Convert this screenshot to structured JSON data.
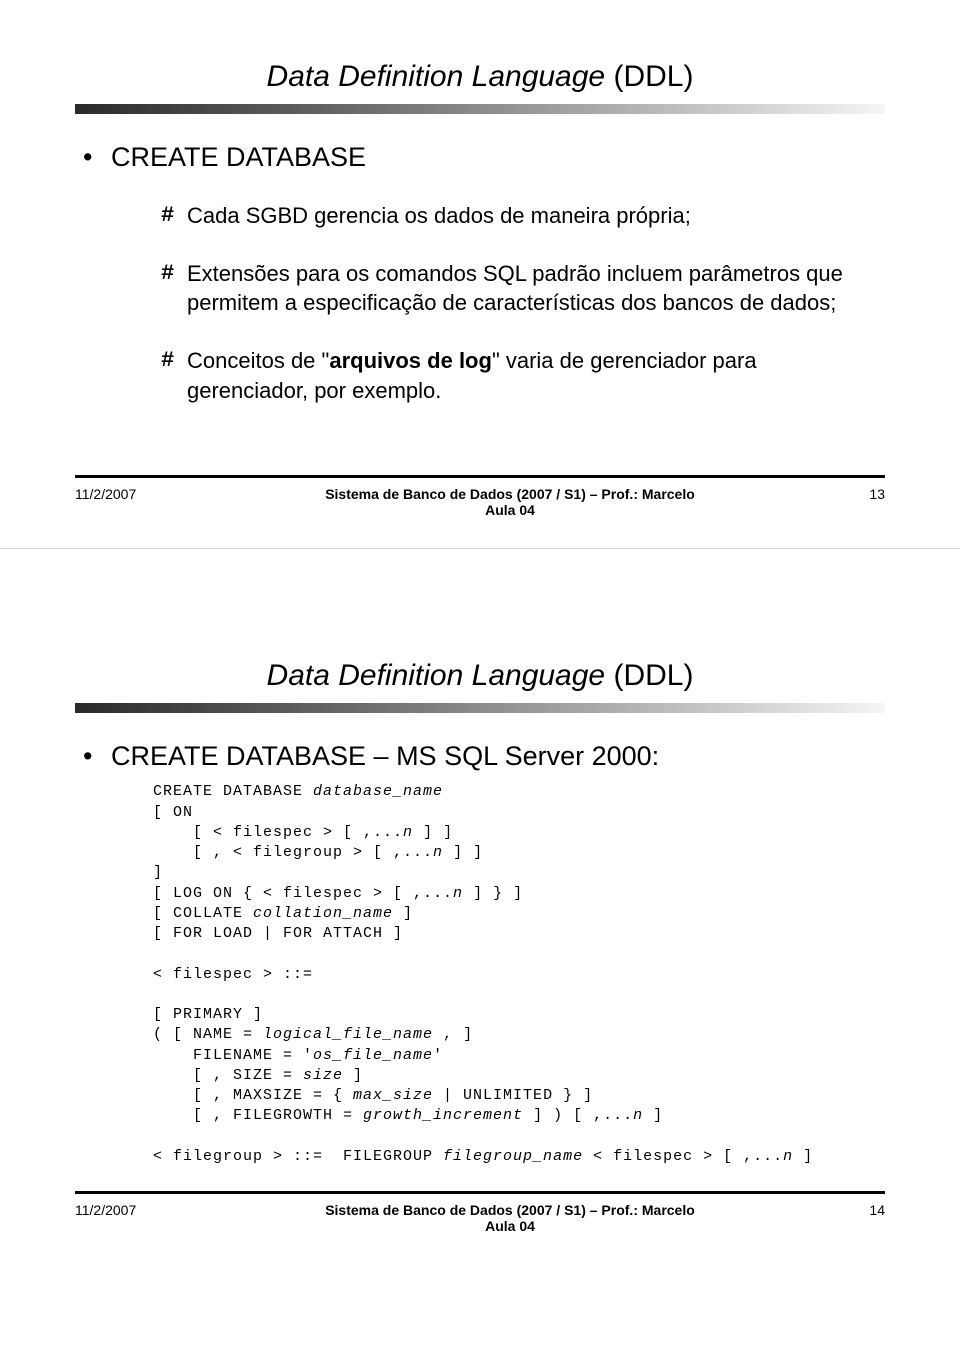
{
  "slide1": {
    "title_ital": "Data Definition Language",
    "title_rest": " (DDL)",
    "h1": "CREATE DATABASE",
    "p1": "Cada SGBD gerencia os dados de maneira própria;",
    "p2": "Extensões para os comandos SQL padrão incluem parâmetros que permitem a especificação de características dos bancos de dados;",
    "p3_pre": "Conceitos de \"",
    "p3_bold": "arquivos de log",
    "p3_post": "\" varia de gerenciador para gerenciador, por exemplo.",
    "footer": {
      "date": "11/2/2007",
      "center_l1": "Sistema de Banco de Dados (2007 / S1) – Prof.: Marcelo",
      "center_l2": "Aula 04",
      "num": "13"
    }
  },
  "slide2": {
    "title_ital": "Data Definition Language",
    "title_rest": " (DDL)",
    "h1": "CREATE DATABASE – MS SQL Server 2000:",
    "code": {
      "l01a": "CREATE DATABASE ",
      "l01b": "database_name",
      "l02": "[ ON",
      "l03a": "    [ < filespec > [ ,...",
      "l03b": "n",
      "l03c": " ] ]",
      "l04a": "    [ , < filegroup > [ ,...",
      "l04b": "n",
      "l04c": " ] ]",
      "l05": "]",
      "l06a": "[ LOG ON { < filespec > [ ,...",
      "l06b": "n",
      "l06c": " ] } ]",
      "l07a": "[ COLLATE ",
      "l07b": "collation_name",
      "l07c": " ]",
      "l08": "[ FOR LOAD | FOR ATTACH ]",
      "l09": "",
      "l10": "< filespec > ::=",
      "l11": "",
      "l12": "[ PRIMARY ]",
      "l13a": "( [ NAME = ",
      "l13b": "logical_file_name",
      "l13c": " , ]",
      "l14a": "    FILENAME = '",
      "l14b": "os_file_name",
      "l14c": "'",
      "l15a": "    [ , SIZE = ",
      "l15b": "size",
      "l15c": " ]",
      "l16a": "    [ , MAXSIZE = { ",
      "l16b": "max_size",
      "l16c": " | UNLIMITED } ]",
      "l17a": "    [ , FILEGROWTH = ",
      "l17b": "growth_increment",
      "l17c": " ] ) [ ,...",
      "l17d": "n",
      "l17e": " ]",
      "l18": "",
      "l19a": "< filegroup > ::=  FILEGROUP ",
      "l19b": "filegroup_name",
      "l19c": " < filespec > [ ,...",
      "l19d": "n",
      "l19e": " ]"
    },
    "footer": {
      "date": "11/2/2007",
      "center_l1": "Sistema de Banco de Dados (2007 / S1) – Prof.: Marcelo",
      "center_l2": "Aula 04",
      "num": "14"
    }
  }
}
